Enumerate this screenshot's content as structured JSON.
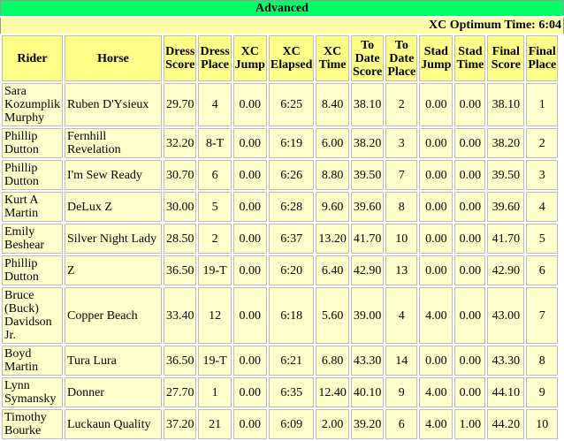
{
  "section_title": "Advanced",
  "optimum_time": "XC Optimum Time: 6:04",
  "headers": [
    "Rider",
    "Horse",
    "Dress Score",
    "Dress Place",
    "XC Jump",
    "XC Elapsed",
    "XC Time",
    "To Date Score",
    "To Date Place",
    "Stad Jump",
    "Stad Time",
    "Final Score",
    "Final Place"
  ],
  "rows": [
    [
      "Sara Kozumplik Murphy",
      "Ruben D'Ysieux",
      "29.70",
      "4",
      "0.00",
      "6:25",
      "8.40",
      "38.10",
      "2",
      "0.00",
      "0.00",
      "38.10",
      "1"
    ],
    [
      "Phillip Dutton",
      "Fernhill Revelation",
      "32.20",
      "8-T",
      "0.00",
      "6:19",
      "6.00",
      "38.20",
      "3",
      "0.00",
      "0.00",
      "38.20",
      "2"
    ],
    [
      "Phillip Dutton",
      "I'm Sew Ready",
      "30.70",
      "6",
      "0.00",
      "6:26",
      "8.80",
      "39.50",
      "7",
      "0.00",
      "0.00",
      "39.50",
      "3"
    ],
    [
      "Kurt A Martin",
      "DeLux Z",
      "30.00",
      "5",
      "0.00",
      "6:28",
      "9.60",
      "39.60",
      "8",
      "0.00",
      "0.00",
      "39.60",
      "4"
    ],
    [
      "Emily Beshear",
      "Silver Night Lady",
      "28.50",
      "2",
      "0.00",
      "6:37",
      "13.20",
      "41.70",
      "10",
      "0.00",
      "0.00",
      "41.70",
      "5"
    ],
    [
      "Phillip Dutton",
      "Z",
      "36.50",
      "19-T",
      "0.00",
      "6:20",
      "6.40",
      "42.90",
      "13",
      "0.00",
      "0.00",
      "42.90",
      "6"
    ],
    [
      "Bruce (Buck) Davidson Jr.",
      "Copper Beach",
      "33.40",
      "12",
      "0.00",
      "6:18",
      "5.60",
      "39.00",
      "4",
      "4.00",
      "0.00",
      "43.00",
      "7"
    ],
    [
      "Boyd Martin",
      "Tura Lura",
      "36.50",
      "19-T",
      "0.00",
      "6:21",
      "6.80",
      "43.30",
      "14",
      "0.00",
      "0.00",
      "43.30",
      "8"
    ],
    [
      "Lynn Symansky",
      "Donner",
      "27.70",
      "1",
      "0.00",
      "6:35",
      "12.40",
      "40.10",
      "9",
      "4.00",
      "0.00",
      "44.10",
      "9"
    ],
    [
      "Timothy Bourke",
      "Luckaun Quality",
      "37.20",
      "21",
      "0.00",
      "6:09",
      "2.00",
      "39.20",
      "6",
      "4.00",
      "1.00",
      "44.20",
      "10"
    ]
  ]
}
